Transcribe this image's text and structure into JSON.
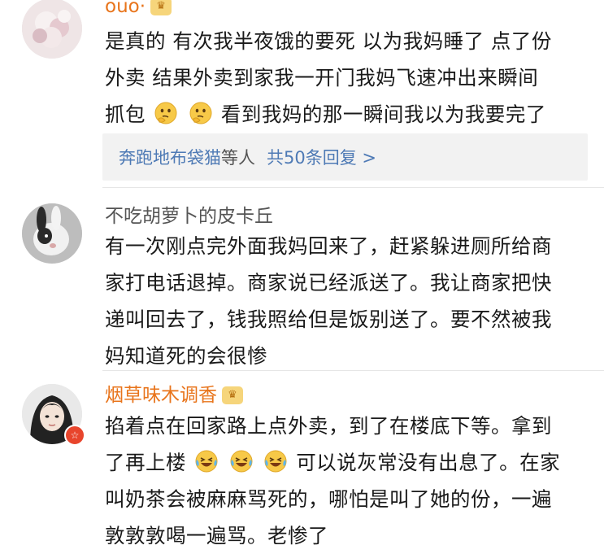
{
  "comments": [
    {
      "username": "ouo·",
      "text_line1": "是真的 有次我半夜饿的要死 以为我妈睡了 点了份",
      "text_line2": "外卖 结果外卖到家我一开门我妈飞速冲出来瞬间",
      "text_line3_a": "抓包",
      "text_line3_b": "看到我妈的那一瞬间我以为我要完了",
      "reply_summary": {
        "link_user": "奔跑地布袋猫",
        "plain": "等人",
        "count_link": "共50条回复 >"
      }
    },
    {
      "username": "不吃胡萝卜的皮卡丘",
      "text_line1": "有一次刚点完外面我妈回来了，赶紧躲进厕所给商",
      "text_line2": "家打电话退掉。商家说已经派送了。我让商家把快",
      "text_line3": "递叫回去了，钱我照给但是饭别送了。要不然被我",
      "text_line4": "妈知道死的会很惨"
    },
    {
      "username": "烟草味木调香",
      "text_line1": "掐着点在回家路上点外卖，到了在楼底下等。拿到",
      "text_line2_a": "了再上楼",
      "text_line2_b": "可以说灰常没有出息了。在家",
      "text_line3": "叫奶茶会被麻麻骂死的，哪怕是叫了她的份，一遍",
      "text_line4": "敦敦敦喝一遍骂。老惨了"
    }
  ],
  "colors": {
    "vip_name": "#e8741b",
    "normal_name": "#555555",
    "link": "#4e7ab5",
    "reply_bg": "#f2f2f2"
  },
  "icons": {
    "thinking": "thinking-face-emoji",
    "laughing": "laughing-crying-emoji"
  }
}
